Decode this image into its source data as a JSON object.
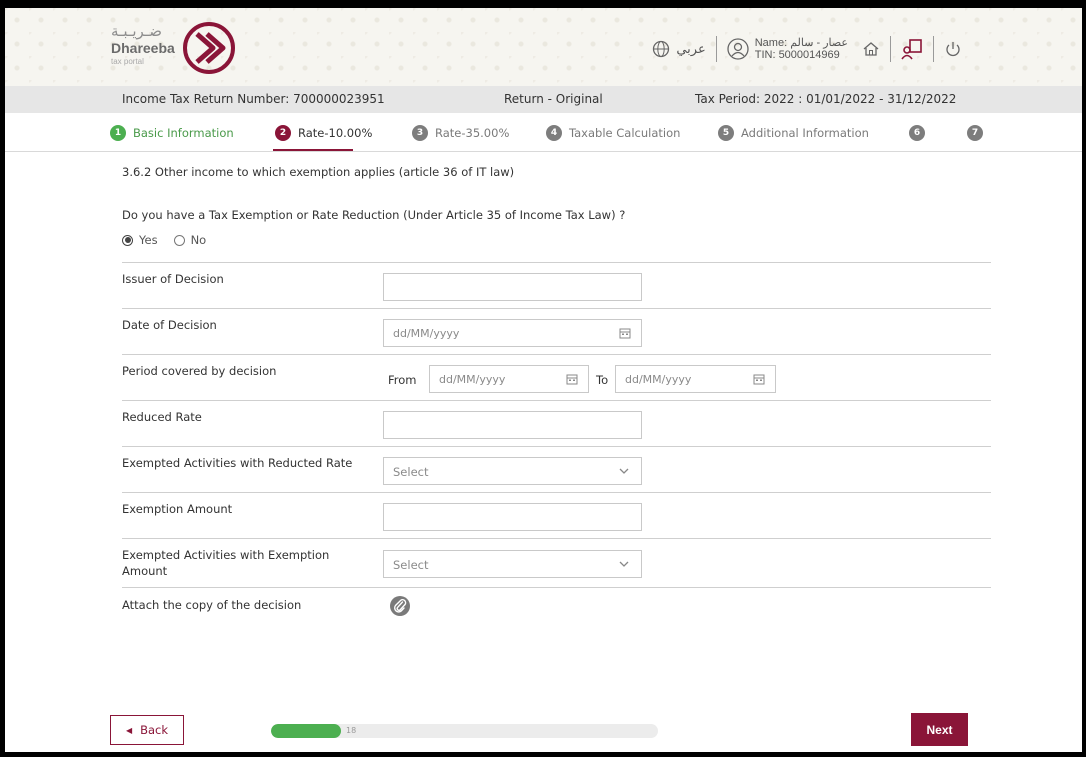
{
  "header": {
    "logo": {
      "arabic": "ضـريـبـة",
      "name": "Dhareeba",
      "sub": "tax portal"
    },
    "language": "عربي",
    "user": {
      "name": "Name: عصار - سالم",
      "tin": "TIN: 5000014969"
    }
  },
  "infobar": {
    "return_number": "Income Tax Return Number: 700000023951",
    "return_type": "Return - Original",
    "tax_period": "Tax Period: 2022 : 01/01/2022 - 31/12/2022"
  },
  "steps": [
    {
      "num": "1",
      "label": "Basic Information",
      "state": "done"
    },
    {
      "num": "2",
      "label": "Rate-10.00%",
      "state": "active"
    },
    {
      "num": "3",
      "label": "Rate-35.00%",
      "state": "pending"
    },
    {
      "num": "4",
      "label": "Taxable Calculation",
      "state": "pending"
    },
    {
      "num": "5",
      "label": "Additional Information",
      "state": "pending"
    },
    {
      "num": "6",
      "label": "",
      "state": "pending"
    },
    {
      "num": "7",
      "label": "",
      "state": "pending"
    }
  ],
  "section_note": "3.6.2 Other income to which exemption applies (article 36 of IT law)",
  "question": "Do you have a Tax Exemption or Rate Reduction (Under Article 35 of Income Tax Law) ?",
  "radio": {
    "yes": "Yes",
    "no": "No",
    "selected": "Yes"
  },
  "fields": {
    "issuer": "Issuer of Decision",
    "date": "Date of Decision",
    "period": "Period covered by decision",
    "rate": "Reduced Rate",
    "activities_rate": "Exempted Activities with Reducted Rate",
    "amount": "Exemption Amount",
    "activities_amount_1": "Exempted Activities with Exemption",
    "activities_amount_2": "Amount",
    "attach": "Attach the copy of the decision"
  },
  "placeholders": {
    "date": "dd/MM/yyyy",
    "select": "Select"
  },
  "period_labels": {
    "from": "From",
    "to": "To"
  },
  "footer": {
    "back": "Back",
    "next": "Next",
    "progress_label": "18",
    "progress_fraction": 0.18
  },
  "colors": {
    "brand": "#8a1538",
    "success": "#4caf50"
  }
}
